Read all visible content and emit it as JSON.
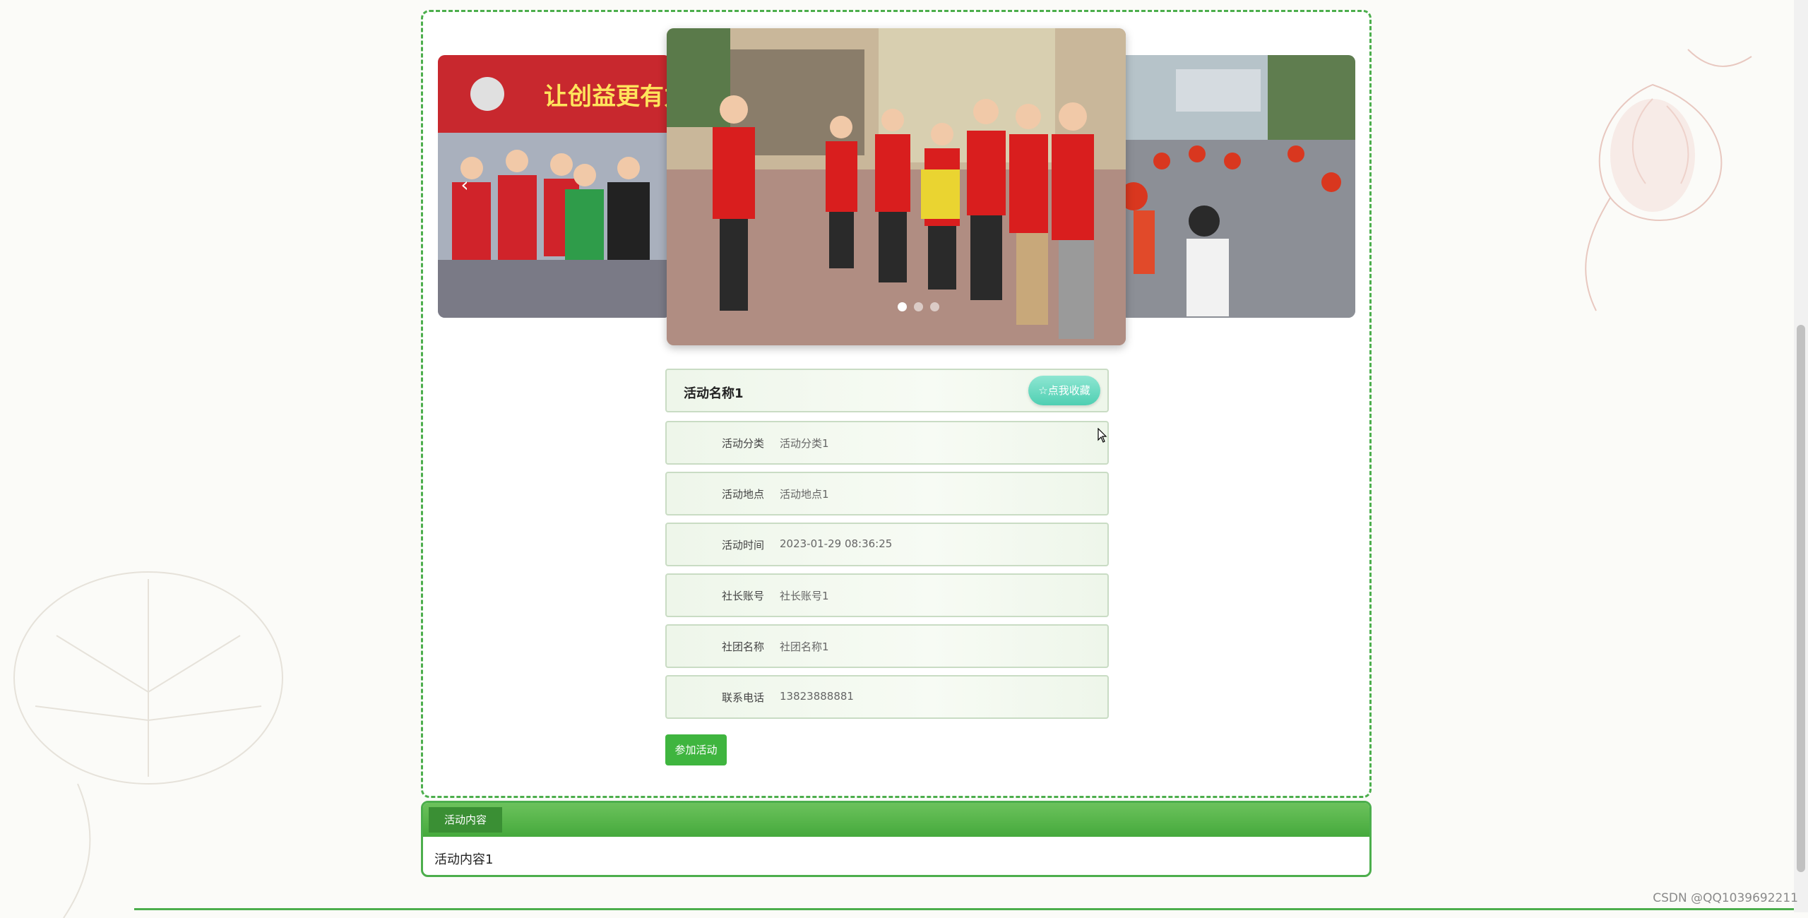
{
  "activity": {
    "name": "活动名称1",
    "favorite_label": "☆点我收藏",
    "join_label": "参加活动"
  },
  "fields": [
    {
      "label": "活动分类",
      "value": "活动分类1"
    },
    {
      "label": "活动地点",
      "value": "活动地点1"
    },
    {
      "label": "活动时间",
      "value": "2023-01-29 08:36:25"
    },
    {
      "label": "社长账号",
      "value": "社长账号1"
    },
    {
      "label": "社团名称",
      "value": "社团名称1"
    },
    {
      "label": "联系电话",
      "value": "13823888881"
    }
  ],
  "carousel": {
    "banner_text": "让创益更有力量",
    "prev_icon": "chevron-left-icon",
    "slide_count": 3,
    "active_index": 0
  },
  "content": {
    "tab_label": "活动内容",
    "body": "活动内容1"
  },
  "watermark": "CSDN @QQ1039692211",
  "colors": {
    "accent_green": "#4cae4c",
    "join_button": "#3fb53f",
    "favorite_button": "#4fcfb2"
  }
}
